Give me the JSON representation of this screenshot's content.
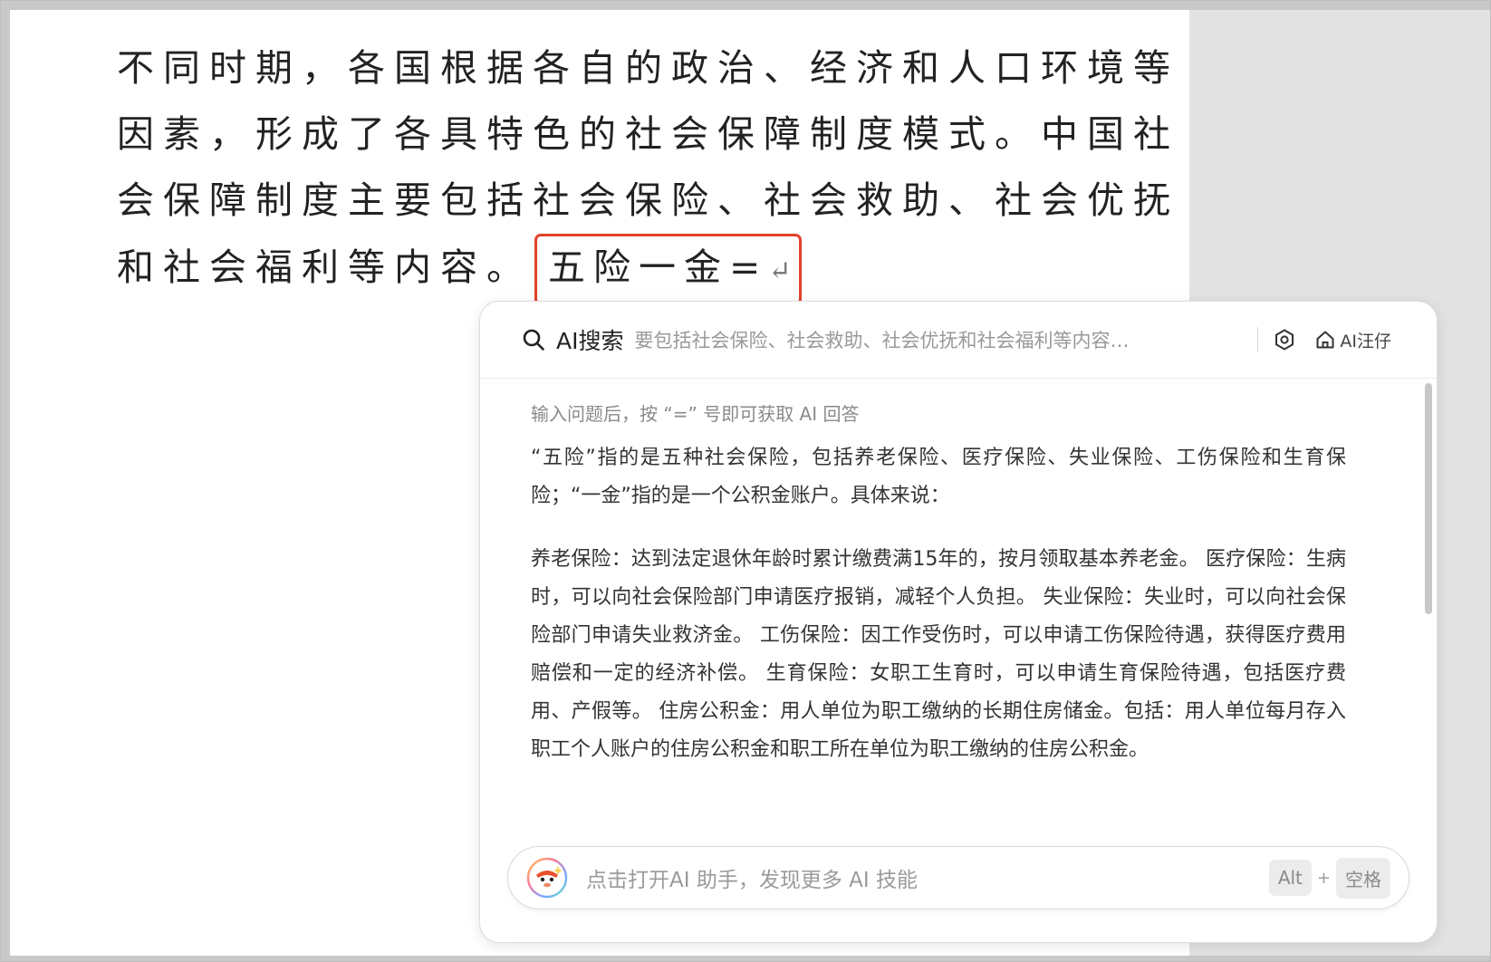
{
  "document": {
    "lines": [
      "不同时期，各国根据各自的政治、经济和人口环境等",
      "因素，形成了各具特色的社会保障制度模式。中国社",
      "会保障制度主要包括社会保险、社会救助、社会优抚",
      "和社会福利等内容。"
    ],
    "query_text": "五险一金=",
    "return_mark": "↵"
  },
  "ai_panel": {
    "title": "AI搜索",
    "search_query": "要包括社会保险、社会救助、社会优抚和社会福利等内容…",
    "brand_label": "AI汪仔",
    "hint": "输入问题后，按 “=” 号即可获取 AI 回答",
    "answer_paragraphs": [
      "“五险”指的是五种社会保险，包括养老保险、医疗保险、失业保险、工伤保险和生育保险；“一金”指的是一个公积金账户。具体来说：",
      "养老保险：达到法定退休年龄时累计缴费满15年的，按月领取基本养老金。 医疗保险：生病时，可以向社会保险部门申请医疗报销，减轻个人负担。 失业保险：失业时，可以向社会保险部门申请失业救济金。 工伤保险：因工作受伤时，可以申请工伤保险待遇，获得医疗费用赔偿和一定的经济补偿。 生育保险：女职工生育时，可以申请生育保险待遇，包括医疗费用、产假等。 住房公积金：用人单位为职工缴纳的长期住房储金。包括：用人单位每月存入职工个人账户的住房公积金和职工所在单位为职工缴纳的住房公积金。"
    ],
    "assistant_prompt": "点击打开AI 助手，发现更多 AI 技能",
    "shortcut": {
      "key1": "Alt",
      "plus": "+",
      "key2": "空格"
    }
  },
  "icons": {
    "search": "search-icon",
    "settings": "settings-icon",
    "home": "home-icon",
    "avatar": "assistant-avatar-icon"
  },
  "colors": {
    "query_highlight_border": "#e2402c",
    "page_background": "#ffffff",
    "side_background": "#e2e2e2"
  }
}
